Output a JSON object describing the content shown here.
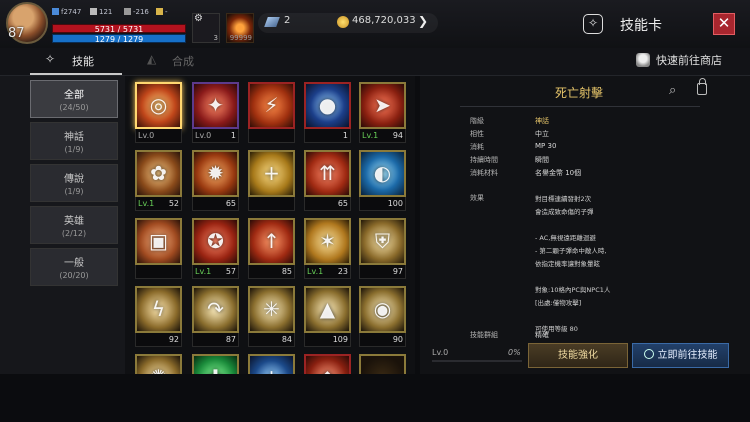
{
  "hud": {
    "level": "87",
    "stats": [
      {
        "icon": "defense-icon",
        "value": "f2747"
      },
      {
        "icon": "attack-icon",
        "value": "121"
      },
      {
        "icon": "karma-icon",
        "value": "-216"
      },
      {
        "icon": "trophy-icon",
        "value": "-"
      }
    ],
    "hp": "5731 / 5731",
    "mp": "1279 / 1279",
    "potion_count": "3",
    "scroll_count": "99999",
    "crystal": "2",
    "gold": "468,720,033"
  },
  "header": {
    "title": "技能卡",
    "close": "✕"
  },
  "tabs": {
    "skill": "技能",
    "synth": "合成",
    "shop": "快速前往商店"
  },
  "sidebar": {
    "items": [
      {
        "label": "全部",
        "count": "(24/50)"
      },
      {
        "label": "神話",
        "count": "(1/9)"
      },
      {
        "label": "傳說",
        "count": "(1/9)"
      },
      {
        "label": "英雄",
        "count": "(2/12)"
      },
      {
        "label": "一般",
        "count": "(20/20)"
      }
    ]
  },
  "grid": [
    {
      "lv": "Lv.0",
      "lvc": "gray",
      "count": "",
      "glyph": "◎",
      "bg": "radial-gradient(circle,#ffce7a,#c0461a 55%,#3a1208)",
      "border": "sel"
    },
    {
      "lv": "Lv.0",
      "lvc": "gray",
      "count": "1",
      "glyph": "✦",
      "bg": "radial-gradient(circle,#ff8a66,#8a1a1a 60%,#2a0808)",
      "border": "purple"
    },
    {
      "lv": "",
      "lvc": "gray",
      "count": "",
      "glyph": "⚡",
      "bg": "radial-gradient(circle,#ff8c4a,#a0300f 60%,#300d06)",
      "border": "red"
    },
    {
      "lv": "",
      "lvc": "gray",
      "count": "1",
      "glyph": "●",
      "bg": "radial-gradient(circle,#9ad3ff,#1c3f8a 55%,#09122a)",
      "border": "red"
    },
    {
      "lv": "Lv.1",
      "lvc": "green",
      "count": "94",
      "glyph": "➤",
      "bg": "radial-gradient(circle,#ff7a5a,#8a2010 60%,#2a0a06)",
      "border": "yellow"
    },
    {
      "lv": "Lv.1",
      "lvc": "green",
      "count": "52",
      "glyph": "✿",
      "bg": "radial-gradient(circle,#ffd08a,#8a4a1a 60%,#2a140a)",
      "border": "yellow"
    },
    {
      "lv": "",
      "lvc": "gray",
      "count": "65",
      "glyph": "✹",
      "bg": "radial-gradient(circle,#ffb26a,#9a3a10 60%,#2a0e06)",
      "border": "yellow"
    },
    {
      "lv": "",
      "lvc": "gray",
      "count": "",
      "glyph": "+",
      "bg": "radial-gradient(circle,#ffe08a,#a87a1a 60%,#2a1e06)",
      "border": "yellow"
    },
    {
      "lv": "",
      "lvc": "gray",
      "count": "65",
      "glyph": "⇈",
      "bg": "radial-gradient(circle,#ff8a6a,#a02a12 60%,#2a0a06)",
      "border": "yellow"
    },
    {
      "lv": "",
      "lvc": "gray",
      "count": "100",
      "glyph": "◐",
      "bg": "radial-gradient(circle,#a6e6ff,#1c6aa8 55%,#08203a)",
      "border": "yellow"
    },
    {
      "lv": "",
      "lvc": "gray",
      "count": "",
      "glyph": "▣",
      "bg": "radial-gradient(circle,#ffb886,#a04a20 60%,#2a1208)",
      "border": "yellow"
    },
    {
      "lv": "Lv.1",
      "lvc": "green",
      "count": "57",
      "glyph": "✪",
      "bg": "radial-gradient(circle,#ff8a6a,#9a2412 60%,#2a0a06)",
      "border": "yellow"
    },
    {
      "lv": "",
      "lvc": "gray",
      "count": "85",
      "glyph": "↑",
      "bg": "radial-gradient(circle,#ff9a6a,#a02a12 60%,#2a0a06)",
      "border": "yellow"
    },
    {
      "lv": "Lv.1",
      "lvc": "green",
      "count": "23",
      "glyph": "✶",
      "bg": "radial-gradient(circle,#ffe6a0,#b0781e 60%,#2a1c06)",
      "border": "yellow"
    },
    {
      "lv": "",
      "lvc": "gray",
      "count": "97",
      "glyph": "⛨",
      "bg": "radial-gradient(circle,#ffeab0,#8a6a2a 60%,#221808)",
      "border": "yellow"
    },
    {
      "lv": "",
      "lvc": "gray",
      "count": "92",
      "glyph": "ϟ",
      "bg": "radial-gradient(circle,#ffe8b0,#8a6a2a 60%,#1a1208)",
      "border": "yellow"
    },
    {
      "lv": "",
      "lvc": "gray",
      "count": "87",
      "glyph": "↷",
      "bg": "radial-gradient(circle,#ffefc0,#8a6e2e 60%,#1a1208)",
      "border": "yellow"
    },
    {
      "lv": "",
      "lvc": "gray",
      "count": "84",
      "glyph": "✳",
      "bg": "radial-gradient(circle,#ffefc0,#8a6e2e 60%,#1a1208)",
      "border": "yellow"
    },
    {
      "lv": "",
      "lvc": "gray",
      "count": "109",
      "glyph": "▲",
      "bg": "radial-gradient(circle,#ffefc0,#8a6e2e 60%,#1a1208)",
      "border": "yellow"
    },
    {
      "lv": "",
      "lvc": "gray",
      "count": "90",
      "glyph": "◉",
      "bg": "radial-gradient(circle,#ffefc0,#8a6e2e 60%,#1a1208)",
      "border": "yellow"
    },
    {
      "lv": "",
      "lvc": "gray",
      "count": "",
      "glyph": "✺",
      "bg": "radial-gradient(circle,#ffe8b0,#8a6a2a 60%,#1a1208)",
      "border": "yellow"
    },
    {
      "lv": "",
      "lvc": "gray",
      "count": "",
      "glyph": "✚",
      "bg": "radial-gradient(circle,#8aff9a,#1a8a3a 60%,#062a10)",
      "border": "yellow"
    },
    {
      "lv": "",
      "lvc": "gray",
      "count": "",
      "glyph": "+",
      "bg": "radial-gradient(circle,#9ad3ff,#1c4a8a 55%,#09122a)",
      "border": "yellow"
    },
    {
      "lv": "",
      "lvc": "gray",
      "count": "",
      "glyph": "◆",
      "bg": "radial-gradient(circle,#ff9a7a,#8a2010 60%,#2a0a06)",
      "border": "red"
    },
    {
      "lv": "",
      "lvc": "gray",
      "count": "",
      "glyph": "",
      "bg": "radial-gradient(circle,#3a2a14,#1a120a 70%)",
      "border": "yellow"
    }
  ],
  "details": {
    "skill_name": "死亡射擊",
    "rows": [
      {
        "k": "階級",
        "v": "神話",
        "gold": true
      },
      {
        "k": "相性",
        "v": "中立"
      },
      {
        "k": "消耗",
        "v": "MP 30"
      },
      {
        "k": "持續時間",
        "v": "瞬間"
      },
      {
        "k": "消耗材料",
        "v": "名譽金幣 10個"
      }
    ],
    "effect_key": "效果",
    "effect_lines": [
      "對目標連續發射2次",
      "會造成致命傷的子彈",
      "",
      "- AC,無視遠距離迴避",
      "- 第二顆子彈命中敵人時,",
      "依指定機率讓對象暈眩",
      "",
      "對象:10格內PC與NPC1人",
      "[出處:僅物攻擊]",
      "",
      "可使用等級 80"
    ],
    "group_key": "技能群組",
    "group_val": "精確",
    "progress_level": "Lv.0",
    "progress_pct": "0%",
    "progress_fraction": 0,
    "enhance_btn": "技能強化",
    "goto_btn": "立即前往技能"
  }
}
